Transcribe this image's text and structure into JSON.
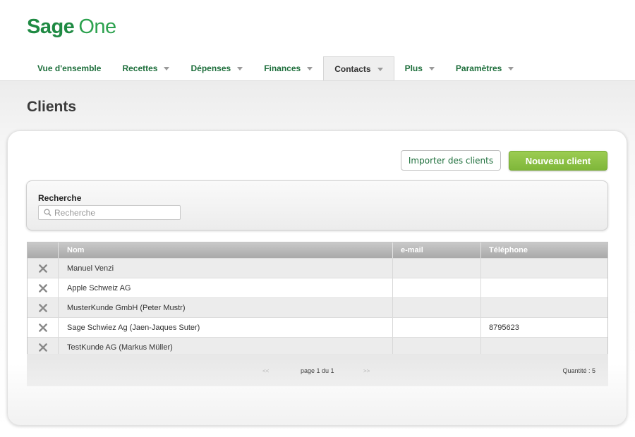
{
  "brand": {
    "name_part1": "Sage",
    "name_part2": "One",
    "color": "#1f8a43"
  },
  "nav": {
    "items": [
      {
        "label": "Vue d'ensemble",
        "has_dropdown": false
      },
      {
        "label": "Recettes",
        "has_dropdown": true
      },
      {
        "label": "Dépenses",
        "has_dropdown": true
      },
      {
        "label": "Finances",
        "has_dropdown": true
      },
      {
        "label": "Contacts",
        "has_dropdown": true,
        "active": true
      },
      {
        "label": "Plus",
        "has_dropdown": true
      },
      {
        "label": "Paramètres",
        "has_dropdown": true
      }
    ]
  },
  "page": {
    "title": "Clients"
  },
  "actions": {
    "import_label": "Importer des clients",
    "new_label": "Nouveau client",
    "new_color": "#8cc146"
  },
  "search": {
    "label": "Recherche",
    "placeholder": "Recherche",
    "value": "",
    "icon": "search-icon"
  },
  "table": {
    "columns": [
      "",
      "Nom",
      "e-mail",
      "Téléphone"
    ],
    "rows": [
      {
        "name": "Manuel Venzi",
        "email": "",
        "phone": ""
      },
      {
        "name": "Apple Schweiz AG",
        "email": "",
        "phone": ""
      },
      {
        "name": "MusterKunde GmbH (Peter Mustr)",
        "email": "",
        "phone": ""
      },
      {
        "name": "Sage Schwiez Ag (Jaen-Jaques Suter)",
        "email": "",
        "phone": "8795623"
      },
      {
        "name": "TestKunde AG (Markus Müller)",
        "email": "",
        "phone": ""
      }
    ],
    "row_action_icon": "delete-x-icon"
  },
  "pagination": {
    "prev": "<<",
    "page_text": "page 1 du 1",
    "next": ">>",
    "quantity": "Quantité : 5"
  }
}
